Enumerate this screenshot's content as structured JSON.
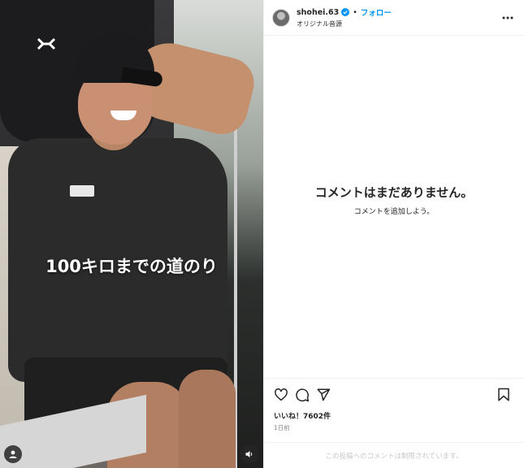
{
  "media": {
    "overlay_caption": "100キロまでの道のり",
    "user_tag_icon": "user-icon",
    "sound_icon": "speaker-icon"
  },
  "header": {
    "username": "shohei.63",
    "separator": "•",
    "follow_label": "フォロー",
    "audio_label": "オリジナル音源",
    "more_icon": "more-icon"
  },
  "comments": {
    "empty_title": "コメントはまだありません。",
    "empty_subtitle": "コメントを追加しよう。"
  },
  "actions": {
    "icons": [
      "heart-icon",
      "comment-icon",
      "share-icon",
      "bookmark-icon"
    ]
  },
  "likes": {
    "text": "いいね！7602件"
  },
  "timestamp": "1日前",
  "comment_limit_notice": "この投稿へのコメントは制限されています。",
  "colors": {
    "follow": "#0095f6",
    "verified": "#0095f6",
    "muted": "#8e8e8e"
  }
}
